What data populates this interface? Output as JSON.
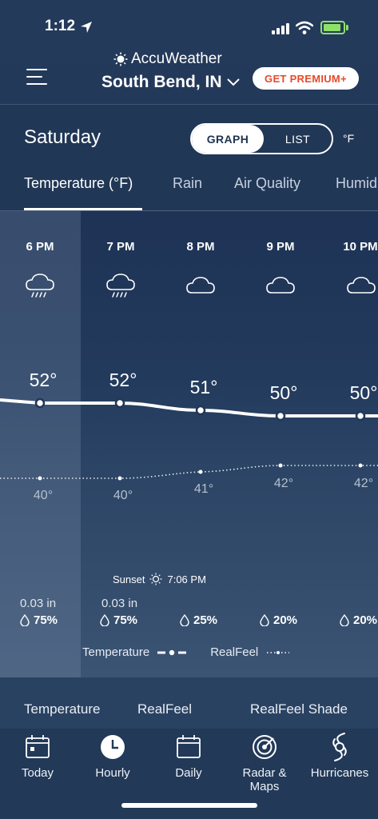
{
  "status_bar": {
    "time": "1:12"
  },
  "header": {
    "brand": "AccuWeather",
    "location": "South Bend, IN",
    "premium_label": "GET PREMIUM+"
  },
  "day": {
    "title": "Saturday",
    "toggle_graph": "GRAPH",
    "toggle_list": "LIST",
    "unit": "°F"
  },
  "tabs": [
    {
      "label": "Temperature (°F)",
      "active": true
    },
    {
      "label": "Rain"
    },
    {
      "label": "Air Quality"
    },
    {
      "label": "Humidity"
    }
  ],
  "hours": [
    {
      "time": "6 PM",
      "icon": "rain-cloud-icon",
      "temp": "52°",
      "realfeel": "40°",
      "precip_amount": "0.03 in",
      "precip_pct": "75%"
    },
    {
      "time": "7 PM",
      "icon": "rain-cloud-icon",
      "temp": "52°",
      "realfeel": "40°",
      "precip_amount": "0.03 in",
      "precip_pct": "75%"
    },
    {
      "time": "8 PM",
      "icon": "cloud-icon",
      "temp": "51°",
      "realfeel": "41°",
      "precip_amount": "",
      "precip_pct": "25%"
    },
    {
      "time": "9 PM",
      "icon": "cloud-icon",
      "temp": "50°",
      "realfeel": "42°",
      "precip_amount": "",
      "precip_pct": "20%"
    },
    {
      "time": "10 PM",
      "icon": "cloud-icon",
      "temp": "50°",
      "realfeel": "42°",
      "precip_amount": "",
      "precip_pct": "20%"
    }
  ],
  "sunset": {
    "label": "Sunset",
    "time": "7:06 PM"
  },
  "legend": {
    "temperature": "Temperature",
    "realfeel": "RealFeel"
  },
  "options": {
    "temperature": "Temperature",
    "realfeel": "RealFeel",
    "realfeel_shade": "RealFeel Shade"
  },
  "nav": [
    {
      "label": "Today",
      "icon": "calendar-today-icon"
    },
    {
      "label": "Hourly",
      "icon": "clock-icon",
      "active": true
    },
    {
      "label": "Daily",
      "icon": "calendar-icon"
    },
    {
      "label": "Radar & Maps",
      "icon": "radar-icon"
    },
    {
      "label": "Hurricanes",
      "icon": "hurricane-icon"
    }
  ],
  "colors": {
    "background": "#213756",
    "premium_text": "#e8492b",
    "battery": "#8ee06a"
  }
}
